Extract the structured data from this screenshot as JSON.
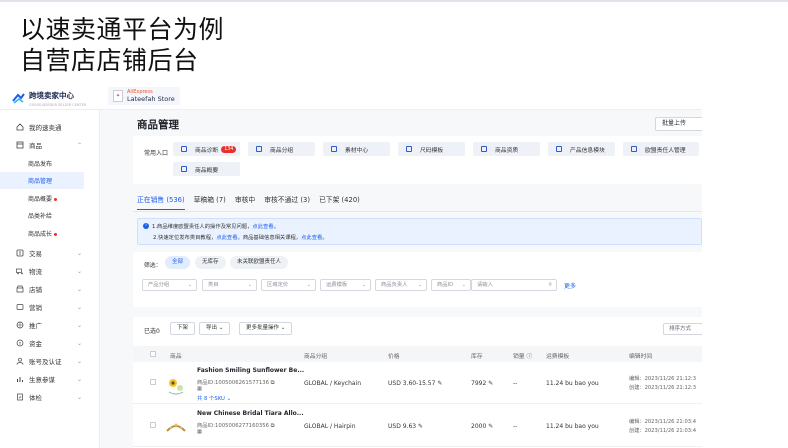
{
  "slide": {
    "title_line1": "以速卖通平台为例",
    "title_line2": "自营店店铺后台"
  },
  "topbar": {
    "brand_name": "跨境卖家中心",
    "brand_sub": "CROSS-BORDER SELLER CENTER",
    "store_platform": "AliExpress",
    "store_name": "Lateefah Store"
  },
  "sidebar": {
    "items": [
      {
        "label": "我的速卖通",
        "icon": "home-icon"
      },
      {
        "label": "商品",
        "icon": "box-icon"
      },
      {
        "label": "交易",
        "icon": "orders-icon"
      },
      {
        "label": "物流",
        "icon": "truck-icon"
      },
      {
        "label": "店铺",
        "icon": "shop-icon"
      },
      {
        "label": "营销",
        "icon": "megaphone-icon"
      },
      {
        "label": "推广",
        "icon": "globe-icon"
      },
      {
        "label": "资金",
        "icon": "wallet-icon"
      },
      {
        "label": "账号及认证",
        "icon": "user-icon"
      },
      {
        "label": "生意参谋",
        "icon": "chart-icon"
      },
      {
        "label": "体检",
        "icon": "checkup-icon"
      }
    ],
    "sub_items": [
      {
        "label": "商品发布"
      },
      {
        "label": "商品管理"
      },
      {
        "label": "商品概要"
      },
      {
        "label": "品类补给"
      },
      {
        "label": "商品成长"
      }
    ]
  },
  "main": {
    "page_title": "商品管理",
    "batch_upload": "批量上传",
    "quick_entry_label": "常用入口",
    "quick_buttons": [
      {
        "label": "商品诊断",
        "count": "134"
      },
      {
        "label": "商品分组"
      },
      {
        "label": "素材中心"
      },
      {
        "label": "尺码模板"
      },
      {
        "label": "商品资质"
      },
      {
        "label": "产品信息模块"
      },
      {
        "label": "欧盟责任人管理"
      },
      {
        "label": "商品概要"
      }
    ],
    "tabs": [
      {
        "label": "正在销售 (536)"
      },
      {
        "label": "草稿箱 (7)"
      },
      {
        "label": "审核中"
      },
      {
        "label": "审核不通过 (3)"
      },
      {
        "label": "已下架 (420)"
      }
    ],
    "notice": {
      "l1_a": "1.商品维度欧盟责任人的操作及常见问题，",
      "l1_link": "点此查看",
      "l1_b": "。",
      "l2_a": "2.快速定位发布类目教程，",
      "l2_link1": "点此查看",
      "l2_b": "。商品基础信息相关课程，",
      "l2_link2": "点此查看",
      "l2_c": "。"
    },
    "filter": {
      "label": "筛选：",
      "chips": [
        "全部",
        "无库存",
        "未关联欧盟责任人"
      ],
      "selects": [
        "产品分组",
        "类目",
        "区域定价",
        "运费模板",
        "商品负责人",
        "商品ID"
      ],
      "input_placeholder": "请输入",
      "search_label": "更多"
    },
    "list": {
      "selected_label": "已选0",
      "btn_off_shelf": "下架",
      "btn_export": "导出",
      "btn_more_batch": "更多批量操作",
      "sort_label": "排序方式",
      "headers": [
        "商品",
        "商品分组",
        "价格",
        "库存",
        "销量",
        "运费模板",
        "编辑时间"
      ],
      "rows": [
        {
          "name": "Fashion Smiling Sunflower Be...",
          "product_id": "商品ID:1005006261577136",
          "sku_more": "共 8 个SKU",
          "group": "GLOBAL / Keychain",
          "price": "USD 3.60-15.57",
          "stock": "7992",
          "sales": "--",
          "shipping": "11.24 bu bao you",
          "edited": "编辑：2023/11/26 21:12:3",
          "created": "创建：2023/11/26 21:12:3"
        },
        {
          "name": "New Chinese Bridal Tiara Allo...",
          "product_id": "商品ID:1005006277160356",
          "group": "GLOBAL / Hairpin",
          "price": "USD 9.63",
          "stock": "2000",
          "sales": "--",
          "shipping": "11.24 bu bao you",
          "edited": "编辑：2023/11/26 21:03:4",
          "created": "创建：2023/11/26 21:03:4"
        }
      ]
    }
  },
  "colors": {
    "accent": "#1a5eea",
    "badge": "#e5322d",
    "sidebar_active_bg": "#eaf1ff"
  }
}
